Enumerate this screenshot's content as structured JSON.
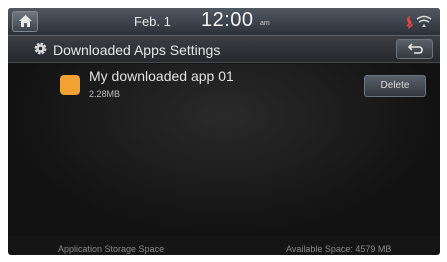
{
  "statusbar": {
    "date": "Feb.  1",
    "time": "12:00",
    "ampm": "am",
    "icons": [
      "home-icon",
      "bluetooth-icon",
      "signal-icon"
    ]
  },
  "header": {
    "title": "Downloaded Apps Settings",
    "icon": "gear-icon",
    "back_icon": "back-arrow-icon"
  },
  "apps": [
    {
      "name": "My downloaded app 01",
      "size": "2.28MB",
      "icon_color": "#f2a132",
      "action_label": "Delete"
    }
  ],
  "footer": {
    "storage_label": "Application Storage Space",
    "available_space": "Available Space: 4579 MB"
  }
}
